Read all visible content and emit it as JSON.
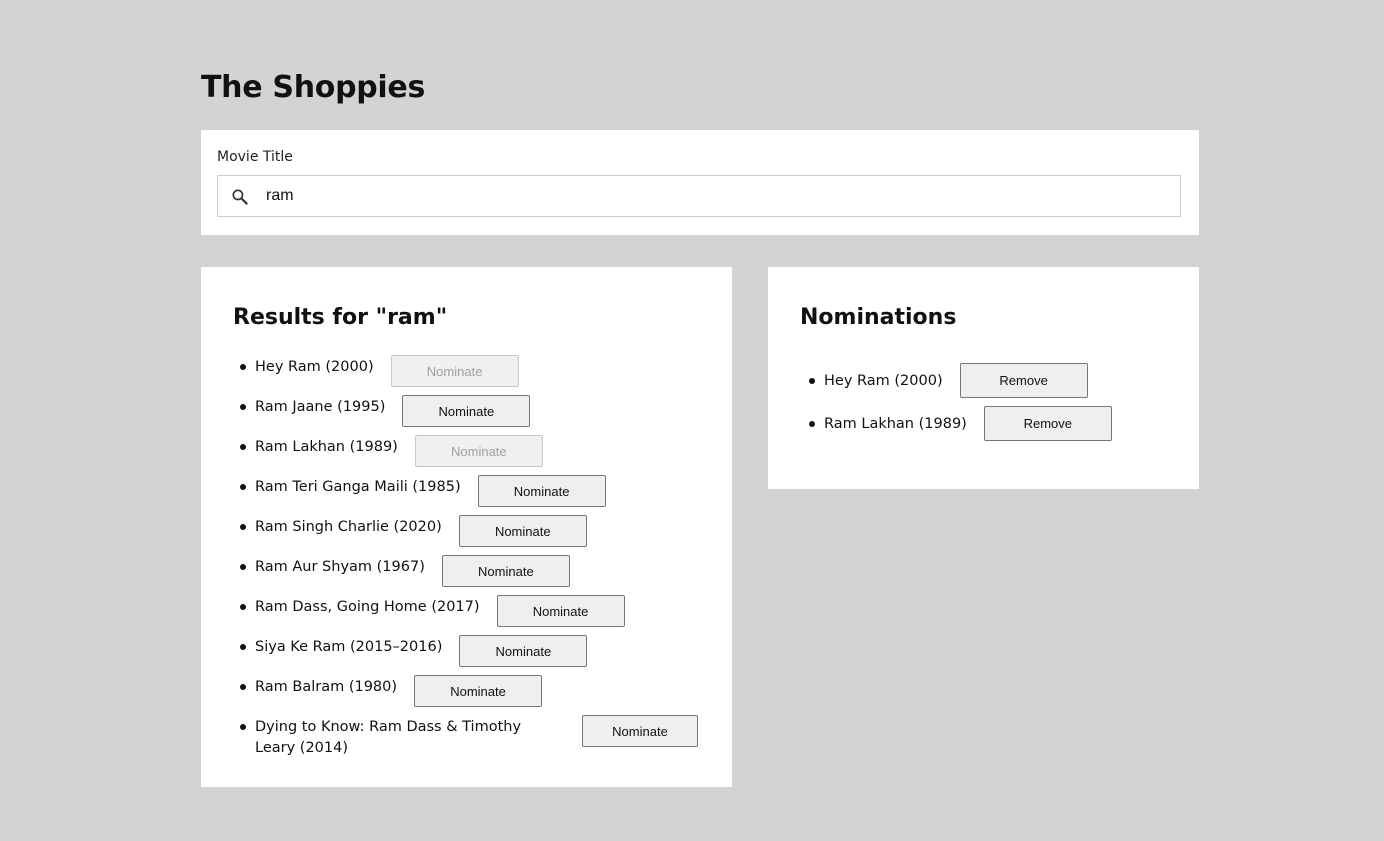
{
  "app": {
    "title": "The Shoppies"
  },
  "search": {
    "label": "Movie Title",
    "value": "ram",
    "placeholder": ""
  },
  "results": {
    "heading": "Results for \"ram\"",
    "items": [
      {
        "title": "Hey Ram (2000)",
        "button": "Nominate",
        "disabled": true
      },
      {
        "title": "Ram Jaane (1995)",
        "button": "Nominate",
        "disabled": false
      },
      {
        "title": "Ram Lakhan (1989)",
        "button": "Nominate",
        "disabled": true
      },
      {
        "title": "Ram Teri Ganga Maili (1985)",
        "button": "Nominate",
        "disabled": false
      },
      {
        "title": "Ram Singh Charlie (2020)",
        "button": "Nominate",
        "disabled": false
      },
      {
        "title": "Ram Aur Shyam (1967)",
        "button": "Nominate",
        "disabled": false
      },
      {
        "title": "Ram Dass, Going Home (2017)",
        "button": "Nominate",
        "disabled": false
      },
      {
        "title": "Siya Ke Ram (2015–2016)",
        "button": "Nominate",
        "disabled": false
      },
      {
        "title": "Ram Balram (1980)",
        "button": "Nominate",
        "disabled": false
      },
      {
        "title": "Dying to Know: Ram Dass & Timothy Leary (2014)",
        "button": "Nominate",
        "disabled": false
      }
    ]
  },
  "nominations": {
    "heading": "Nominations",
    "items": [
      {
        "title": "Hey Ram (2000)",
        "button": "Remove"
      },
      {
        "title": "Ram Lakhan (1989)",
        "button": "Remove"
      }
    ]
  },
  "icons": {
    "search": "search-icon"
  }
}
